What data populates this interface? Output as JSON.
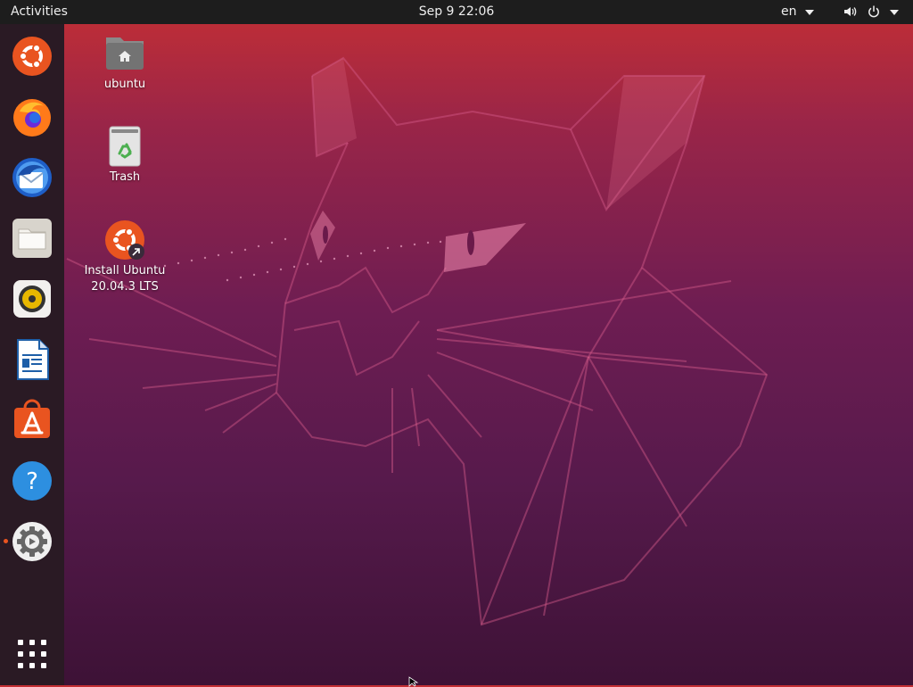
{
  "topbar": {
    "activities": "Activities",
    "clock": "Sep 9  22:06",
    "language": "en",
    "icons": [
      "speaker-icon",
      "power-icon",
      "dropdown-icon"
    ]
  },
  "dock": {
    "apps": [
      {
        "name": "Ubuntu",
        "icon": "ubuntu-logo-icon",
        "running": false
      },
      {
        "name": "Firefox Web Browser",
        "icon": "firefox-icon",
        "running": false
      },
      {
        "name": "Thunderbird Mail",
        "icon": "thunderbird-icon",
        "running": false
      },
      {
        "name": "Files",
        "icon": "files-icon",
        "running": false
      },
      {
        "name": "Rhythmbox",
        "icon": "rhythmbox-icon",
        "running": false
      },
      {
        "name": "LibreOffice Writer",
        "icon": "writer-icon",
        "running": false
      },
      {
        "name": "Ubuntu Software",
        "icon": "software-icon",
        "running": false
      },
      {
        "name": "Help",
        "icon": "help-icon",
        "running": false
      },
      {
        "name": "Settings",
        "icon": "settings-icon",
        "running": true
      }
    ],
    "show_apps_icon": "grid-icon"
  },
  "desktop": {
    "icons": [
      {
        "label": "ubuntu",
        "icon": "home-folder-icon"
      },
      {
        "label": "Trash",
        "icon": "trash-icon"
      },
      {
        "label_line1": "Install Ubuntu",
        "label_line2": "20.04.3 LTS",
        "icon": "install-ubuntu-icon"
      }
    ]
  },
  "colors": {
    "accent": "#e95420",
    "topbar": "#1d1d1d",
    "dock": "#2a1a24"
  }
}
